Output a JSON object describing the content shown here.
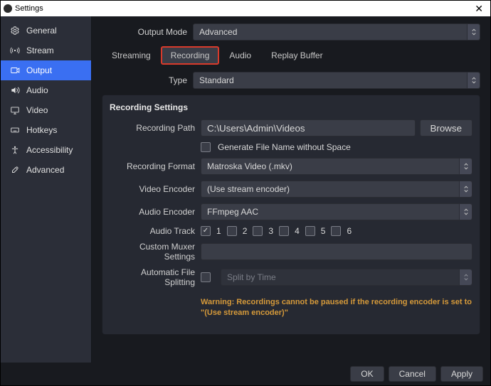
{
  "window": {
    "title": "Settings"
  },
  "outputMode": {
    "label": "Output Mode",
    "value": "Advanced"
  },
  "sidebar": {
    "items": [
      {
        "label": "General"
      },
      {
        "label": "Stream"
      },
      {
        "label": "Output"
      },
      {
        "label": "Audio"
      },
      {
        "label": "Video"
      },
      {
        "label": "Hotkeys"
      },
      {
        "label": "Accessibility"
      },
      {
        "label": "Advanced"
      }
    ]
  },
  "tabs": {
    "items": [
      {
        "label": "Streaming"
      },
      {
        "label": "Recording"
      },
      {
        "label": "Audio"
      },
      {
        "label": "Replay Buffer"
      }
    ]
  },
  "type": {
    "label": "Type",
    "value": "Standard"
  },
  "panel": {
    "title": "Recording Settings",
    "recordingPath": {
      "label": "Recording Path",
      "value": "C:\\Users\\Admin\\Videos",
      "browse": "Browse"
    },
    "fileNoSpace": {
      "label": "Generate File Name without Space",
      "checked": false
    },
    "recordingFormat": {
      "label": "Recording Format",
      "value": "Matroska Video (.mkv)"
    },
    "videoEncoder": {
      "label": "Video Encoder",
      "value": "(Use stream encoder)"
    },
    "audioEncoder": {
      "label": "Audio Encoder",
      "value": "FFmpeg AAC"
    },
    "audioTrack": {
      "label": "Audio Track",
      "tracks": [
        {
          "n": "1",
          "checked": true
        },
        {
          "n": "2",
          "checked": false
        },
        {
          "n": "3",
          "checked": false
        },
        {
          "n": "4",
          "checked": false
        },
        {
          "n": "5",
          "checked": false
        },
        {
          "n": "6",
          "checked": false
        }
      ]
    },
    "customMuxer": {
      "label": "Custom Muxer Settings",
      "value": ""
    },
    "autoSplit": {
      "label": "Automatic File Splitting",
      "checked": false,
      "mode": "Split by Time"
    },
    "warning": "Warning: Recordings cannot be paused if the recording encoder is set to \"(Use stream encoder)\""
  },
  "footer": {
    "ok": "OK",
    "cancel": "Cancel",
    "apply": "Apply"
  }
}
